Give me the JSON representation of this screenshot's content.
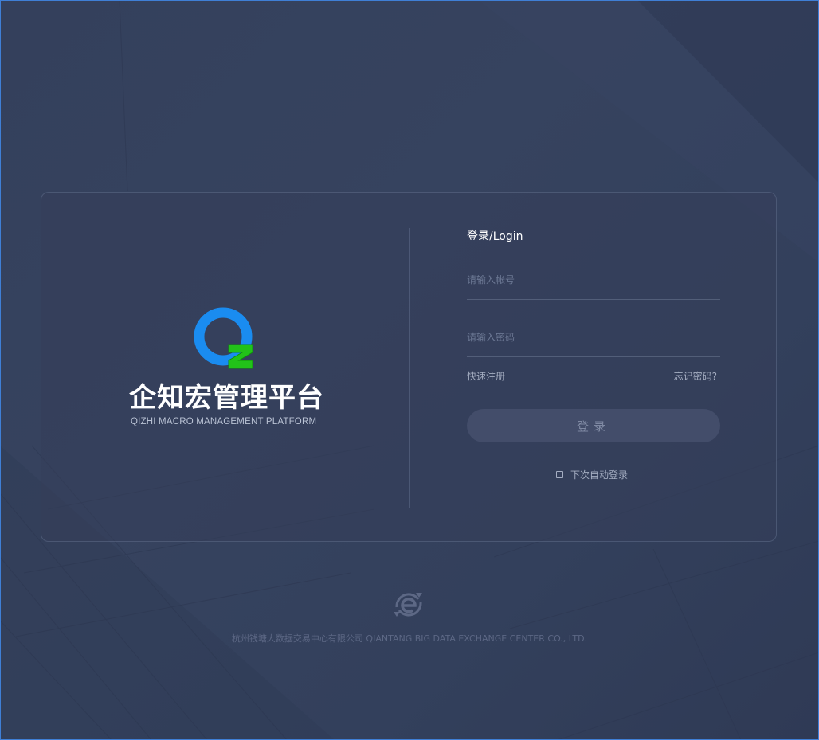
{
  "brand": {
    "name": "企知宏管理平台",
    "subtitle": "QIZHI MACRO MANAGEMENT PLATFORM",
    "logo_icon": "qz-logo-icon",
    "colors": {
      "logo_blue": "#1a8cf0",
      "logo_green": "#22c219"
    }
  },
  "login": {
    "title": "登录/Login",
    "username_placeholder": "请输入帐号",
    "password_placeholder": "请输入密码",
    "register_label": "快速注册",
    "forgot_label": "忘记密码?",
    "submit_label": "登录",
    "auto_login_label": "下次自动登录",
    "auto_login_checked": false
  },
  "footer": {
    "logo_icon": "exchange-logo-icon",
    "company": "杭州钱塘大数据交易中心有限公司 QIANTANG BIG DATA EXCHANGE CENTER CO., LTD."
  },
  "theme": {
    "background": "#36425e",
    "button_bg": "#434d6a",
    "frame_accent": "#3f7fd6"
  }
}
